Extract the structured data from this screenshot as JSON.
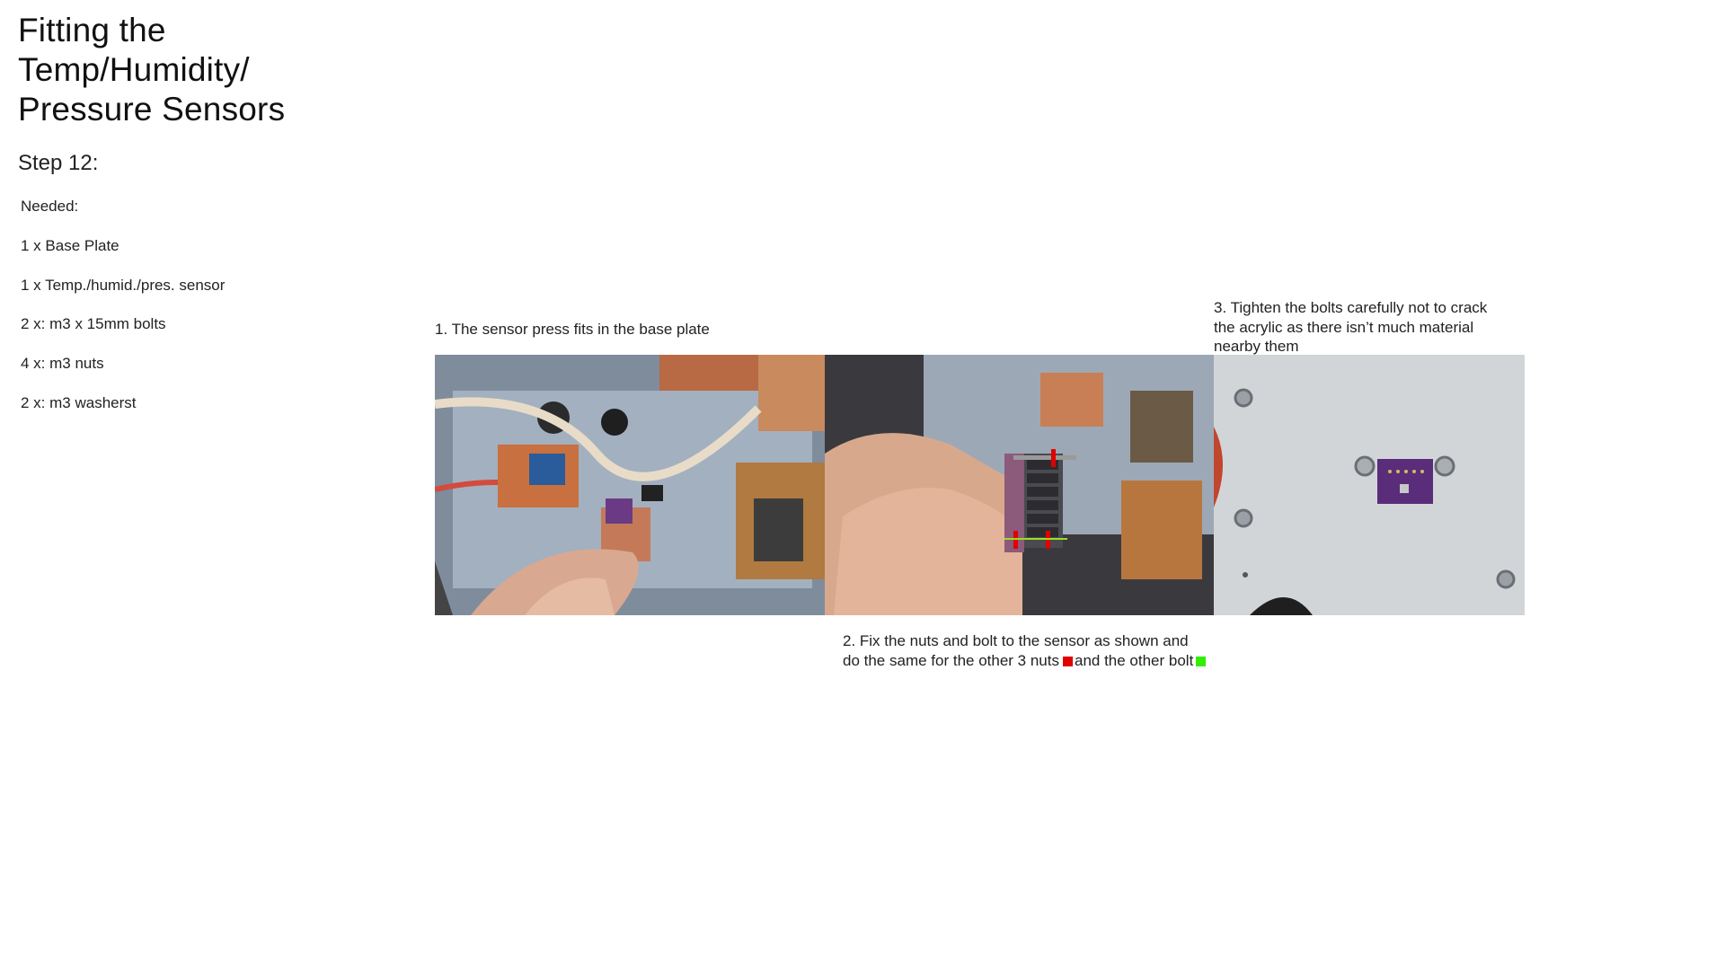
{
  "document": {
    "title_lines": [
      "Fitting the",
      "Temp/Humidity/",
      "Pressure Sensors"
    ],
    "step": "Step 12:",
    "needed_heading": "Needed:",
    "needed_items": [
      "1 x Base Plate",
      "1 x Temp./humid./pres. sensor",
      "2 x: m3 x 15mm bolts",
      "4 x: m3 nuts",
      "2 x: m3 washerst"
    ]
  },
  "captions": {
    "step1": "1. The sensor press fits in the base plate",
    "step2_line1": "2. Fix the nuts and bolt to the sensor as shown and",
    "step2_line2a": "do the same for the other 3 nuts",
    "step2_line2b": "and the other bolt",
    "step3_line1": "3. Tighten the bolts carefully not to crack",
    "step3_line2": "the acrylic as there isn’t much material",
    "step3_line3": "nearby them"
  },
  "colors": {
    "nut_marker": "#e00000",
    "bolt_marker": "#33ee00"
  },
  "images": {
    "photo1": "Sensor press-fit into base plate",
    "photo2": "Nuts and bolt fitted to sensor header",
    "photo3": "Sensor bolted to acrylic base plate"
  }
}
